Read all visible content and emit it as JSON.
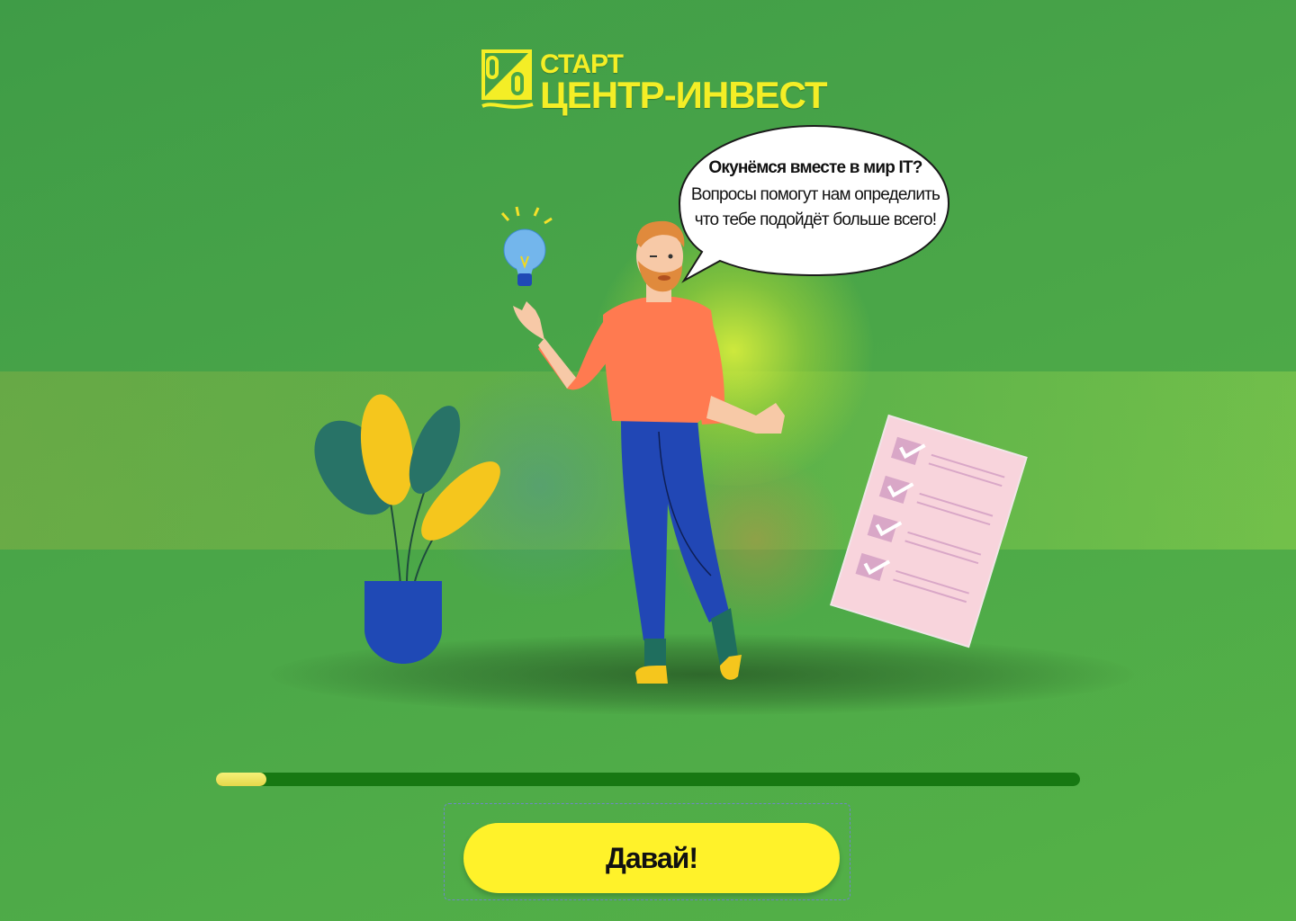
{
  "logo": {
    "line1": "СТАРТ",
    "line2": "ЦЕНТР-ИНВЕСТ",
    "emblem_icon": "percent-coins-icon",
    "color": "#f4ee26"
  },
  "speech_bubble": {
    "title": "Окунёмся вместе в мир IT?",
    "text": "Вопросы помогут нам определить что тебе подойдёт больше всего!"
  },
  "illustration": {
    "lightbulb_icon": "lightbulb-icon",
    "plant_icon": "potted-plant-icon",
    "checklist_icon": "checklist-icon",
    "person": "person-thumbs-up"
  },
  "progress": {
    "value": 0.058,
    "track_color": "#177812",
    "fill_color": "#e9dc4f"
  },
  "cta": {
    "label": "Давай!",
    "color": "#fff22a"
  }
}
